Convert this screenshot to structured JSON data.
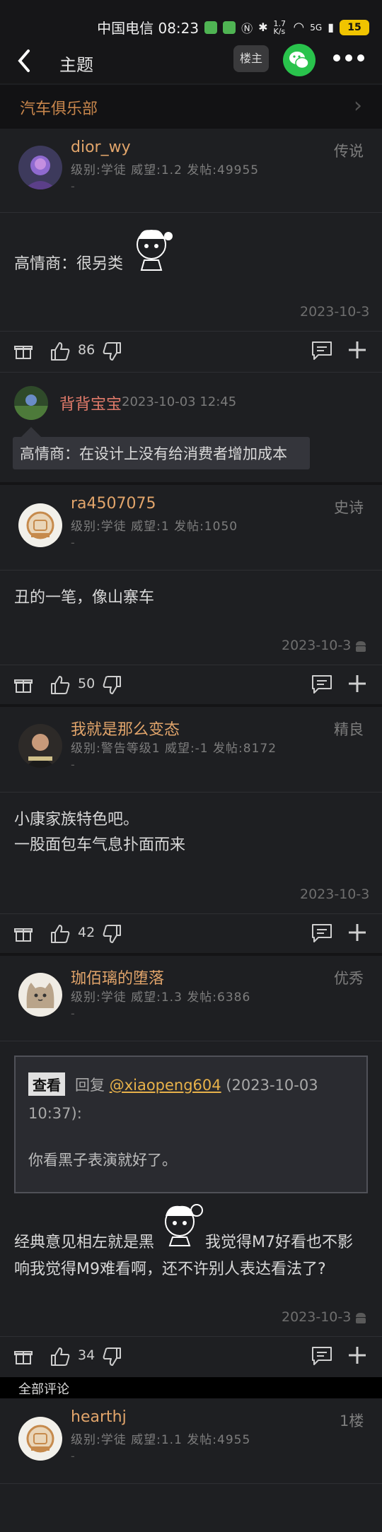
{
  "status_bar": {
    "carrier_time": "中国电信 08:23",
    "net_speed": "1.7 K/s",
    "network": "5G",
    "battery": "15"
  },
  "header": {
    "title": "主题",
    "owner_label": "楼主",
    "back_icon": "chevron-left-icon",
    "wechat_icon": "wechat-icon",
    "more_icon": "more-dots-icon"
  },
  "club": {
    "name": "汽车俱乐部"
  },
  "posts": [
    {
      "username": "dior_wy",
      "tag": "传说",
      "meta": "级别:学徒 威望:1.2 发帖:49955",
      "dash": "-",
      "content": [
        "高情商：很另类"
      ],
      "date": "2023-10-3",
      "likes": "86",
      "comment": {
        "username": "背背宝宝",
        "time": "2023-10-03 12:45",
        "text": "高情商：在设计上没有给消费者增加成本"
      }
    },
    {
      "username": "ra4507075",
      "tag": "史诗",
      "meta": "级别:学徒 威望:1 发帖:1050",
      "dash": "-",
      "content": [
        "丑的一笔，像山寨车"
      ],
      "date": "2023-10-3",
      "likes": "50"
    },
    {
      "username": "我就是那么变态",
      "tag": "精良",
      "meta": "级别:警告等级1 威望:-1 发帖:8172",
      "dash": "-",
      "content": [
        "小康家族特色吧。",
        "一股面包车气息扑面而来"
      ],
      "date": "2023-10-3",
      "likes": "42"
    },
    {
      "username": "珈佰璃的堕落",
      "tag": "优秀",
      "meta": "级别:学徒 威望:1.3 发帖:6386",
      "dash": "-",
      "quote": {
        "view_label": "查看",
        "reply_prefix": "回复",
        "reply_user": "@xiaopeng604",
        "reply_time": "(2023-10-03 10:37):",
        "body": "你看黑子表演就好了。"
      },
      "content": [
        "经典意见相左就是黑",
        "我觉得M7好看也不影",
        "响我觉得M9难看啊，还不许别人表达看法了?"
      ],
      "date": "2023-10-3",
      "likes": "34"
    },
    {
      "username": "hearthj",
      "tag": "1楼",
      "meta": "级别:学徒 威望:1.1 发帖:4955",
      "dash": "-"
    }
  ],
  "all_comments_label": "全部评论",
  "colors": {
    "username": "#e2a56b",
    "accent_green": "#29c34c",
    "quote_user": "#e8b24a"
  }
}
